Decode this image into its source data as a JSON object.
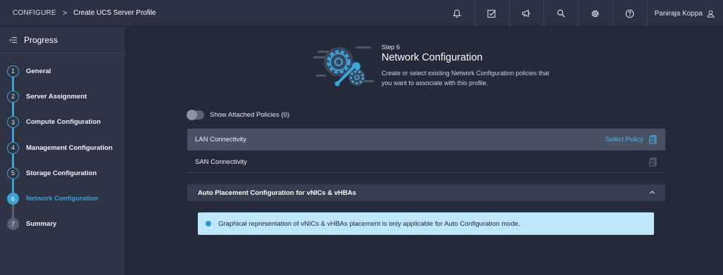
{
  "header": {
    "breadcrumb_root": "CONFIGURE",
    "breadcrumb_separator": ">",
    "page_title": "Create UCS Server Profile",
    "user_name": "Paniraja Koppa",
    "icons": [
      "bell-icon",
      "checklist-icon",
      "megaphone-icon",
      "search-icon",
      "gear-icon",
      "help-icon",
      "user-icon"
    ]
  },
  "sidebar": {
    "title": "Progress",
    "steps": [
      {
        "num": "1",
        "label": "General"
      },
      {
        "num": "2",
        "label": "Server Assignment"
      },
      {
        "num": "3",
        "label": "Compute Configuration"
      },
      {
        "num": "4",
        "label": "Management Configuration"
      },
      {
        "num": "5",
        "label": "Storage Configuration"
      },
      {
        "num": "6",
        "label": "Network Configuration"
      },
      {
        "num": "7",
        "label": "Summary"
      }
    ],
    "active_step": 6
  },
  "main": {
    "step_number": "Step 6",
    "title": "Network Configuration",
    "description": "Create or select existing Network Configuration policies that you want to associate with this profile.",
    "toggle_label": "Show Attached Policies (0)",
    "toggle_on": false,
    "policies": [
      {
        "name": "LAN Connectivity",
        "action": "Select Policy"
      },
      {
        "name": "SAN Connectivity",
        "action": ""
      }
    ],
    "section_title": "Auto Placement Configuration for vNICs & vHBAs",
    "info_message": "Graphical representation of vNICs & vHBAs placement is only applicable for Auto Configuration mode."
  },
  "colors": {
    "accent": "#3aa2d9",
    "link": "#4bb4ee",
    "info_bg": "#bde8fb",
    "background": "#242a38"
  }
}
